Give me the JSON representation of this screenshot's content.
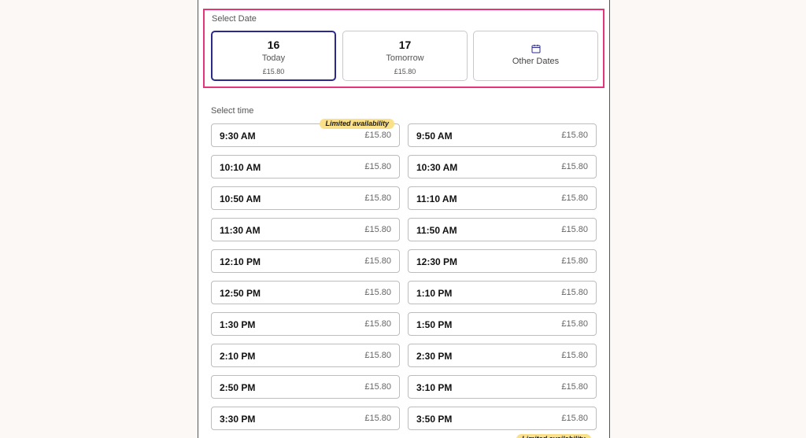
{
  "date_section": {
    "label": "Select Date",
    "dates": [
      {
        "day": "16",
        "sub": "Today",
        "price": "£15.80",
        "selected": true
      },
      {
        "day": "17",
        "sub": "Tomorrow",
        "price": "£15.80",
        "selected": false
      }
    ],
    "other_dates": {
      "label": "Other Dates",
      "icon": "calendar-icon"
    }
  },
  "time_section": {
    "label": "Select time",
    "badge_text": "Limited availability",
    "slots": [
      {
        "time": "9:30 AM",
        "price": "£15.80",
        "limited": true
      },
      {
        "time": "9:50 AM",
        "price": "£15.80",
        "limited": false
      },
      {
        "time": "10:10 AM",
        "price": "£15.80",
        "limited": false
      },
      {
        "time": "10:30 AM",
        "price": "£15.80",
        "limited": false
      },
      {
        "time": "10:50 AM",
        "price": "£15.80",
        "limited": false
      },
      {
        "time": "11:10 AM",
        "price": "£15.80",
        "limited": false
      },
      {
        "time": "11:30 AM",
        "price": "£15.80",
        "limited": false
      },
      {
        "time": "11:50 AM",
        "price": "£15.80",
        "limited": false
      },
      {
        "time": "12:10 PM",
        "price": "£15.80",
        "limited": false
      },
      {
        "time": "12:30 PM",
        "price": "£15.80",
        "limited": false
      },
      {
        "time": "12:50 PM",
        "price": "£15.80",
        "limited": false
      },
      {
        "time": "1:10 PM",
        "price": "£15.80",
        "limited": false
      },
      {
        "time": "1:30 PM",
        "price": "£15.80",
        "limited": false
      },
      {
        "time": "1:50 PM",
        "price": "£15.80",
        "limited": false
      },
      {
        "time": "2:10 PM",
        "price": "£15.80",
        "limited": false
      },
      {
        "time": "2:30 PM",
        "price": "£15.80",
        "limited": false
      },
      {
        "time": "2:50 PM",
        "price": "£15.80",
        "limited": false
      },
      {
        "time": "3:10 PM",
        "price": "£15.80",
        "limited": false
      },
      {
        "time": "3:30 PM",
        "price": "£15.80",
        "limited": false
      },
      {
        "time": "3:50 PM",
        "price": "£15.80",
        "limited": false
      }
    ]
  },
  "colors": {
    "selected_border": "#2b2a8c",
    "highlight_border": "#e5357a",
    "badge_bg": "#fbe08a",
    "page_bg": "#fbf8f5"
  }
}
